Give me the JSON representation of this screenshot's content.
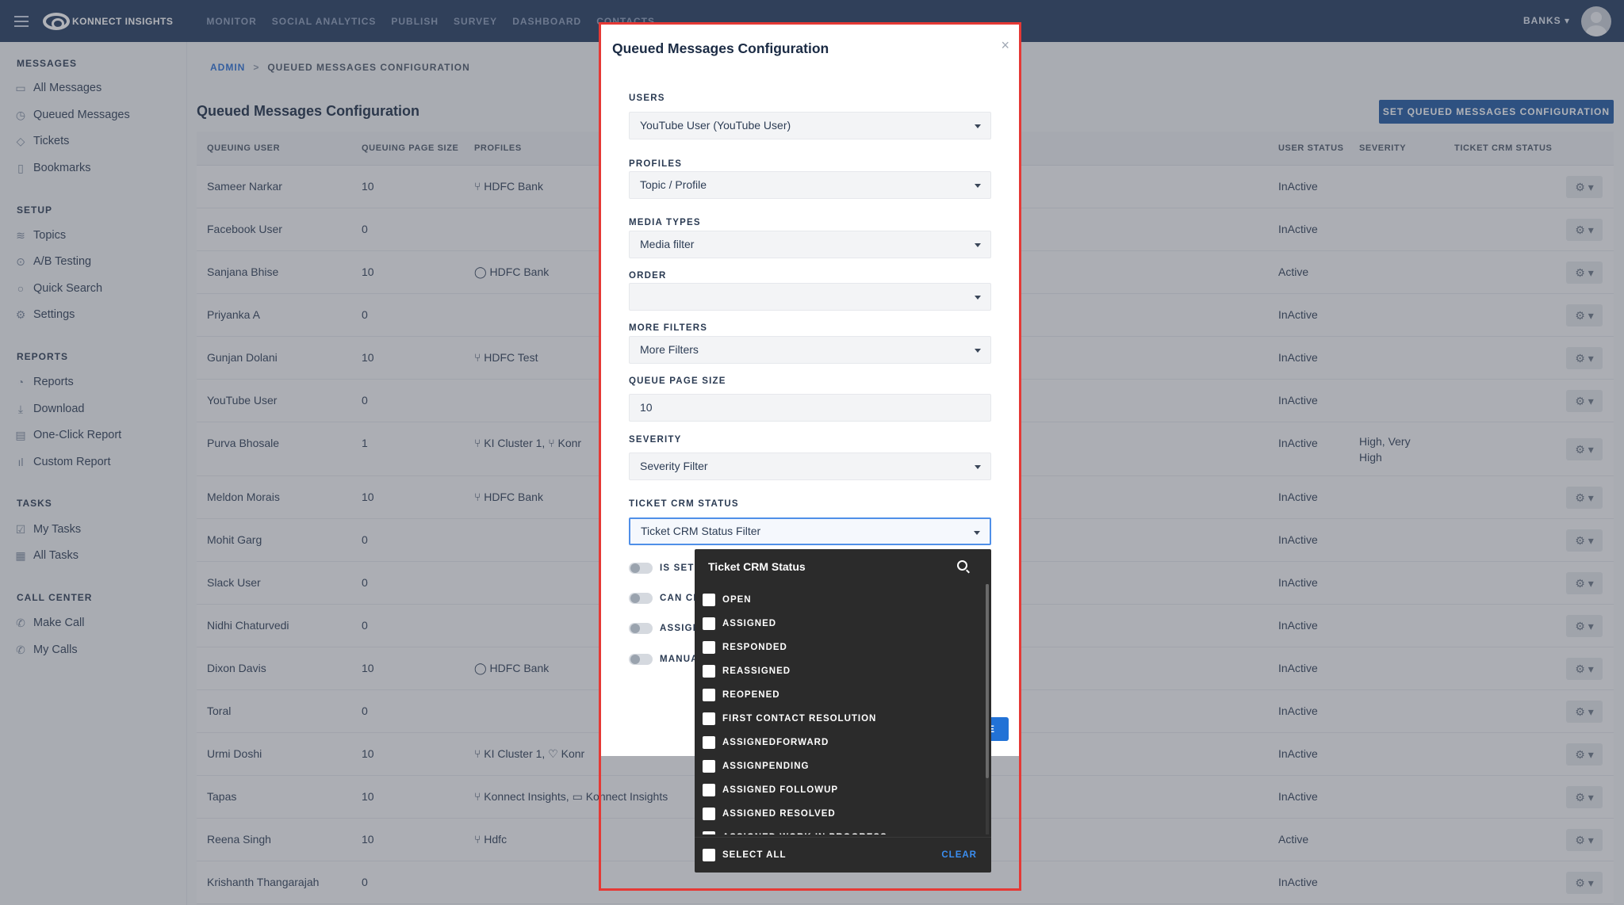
{
  "header": {
    "brand": "KONNECT INSIGHTS",
    "nav": [
      "MONITOR",
      "SOCIAL ANALYTICS",
      "PUBLISH",
      "SURVEY",
      "DASHBOARD",
      "CONTACTS"
    ],
    "account": "BANKS ▾"
  },
  "sidebar": {
    "sections": [
      {
        "title": "MESSAGES",
        "items": [
          "All Messages",
          "Queued Messages",
          "Tickets",
          "Bookmarks"
        ]
      },
      {
        "title": "SETUP",
        "items": [
          "Topics",
          "A/B Testing",
          "Quick Search",
          "Settings"
        ]
      },
      {
        "title": "REPORTS",
        "items": [
          "Reports",
          "Download",
          "One-Click Report",
          "Custom Report"
        ]
      },
      {
        "title": "TASKS",
        "items": [
          "My Tasks",
          "All Tasks"
        ]
      },
      {
        "title": "CALL CENTER",
        "items": [
          "Make Call",
          "My Calls"
        ]
      }
    ]
  },
  "breadcrumb": {
    "root": "ADMIN",
    "sep": ">",
    "current": "QUEUED MESSAGES CONFIGURATION"
  },
  "page": {
    "title": "Queued Messages Configuration",
    "action": "SET QUEUED MESSAGES CONFIGURATION"
  },
  "table": {
    "headers": {
      "queuing_user": "QUEUING USER",
      "page_size": "QUEUING PAGE SIZE",
      "profiles": "PROFILES",
      "user_status": "USER STATUS",
      "severity": "SEVERITY",
      "crm_status": "TICKET CRM STATUS"
    },
    "rows": [
      {
        "user": "Sameer Narkar",
        "size": "10",
        "profile": "⑂ HDFC Bank",
        "status": "InActive",
        "severity": ""
      },
      {
        "user": "Facebook User",
        "size": "0",
        "profile": "",
        "status": "InActive",
        "severity": ""
      },
      {
        "user": "Sanjana Bhise",
        "size": "10",
        "profile": "◯ HDFC Bank",
        "status": "Active",
        "severity": ""
      },
      {
        "user": "Priyanka A",
        "size": "0",
        "profile": "",
        "status": "InActive",
        "severity": ""
      },
      {
        "user": "Gunjan Dolani",
        "size": "10",
        "profile": "⑂ HDFC Test",
        "status": "InActive",
        "severity": ""
      },
      {
        "user": "YouTube User",
        "size": "0",
        "profile": "",
        "status": "InActive",
        "severity": ""
      },
      {
        "user": "Purva Bhosale",
        "size": "1",
        "profile": "⑂ KI Cluster 1, ⑂ Konr",
        "status": "InActive",
        "severity": "High, Very\nHigh"
      },
      {
        "user": "Meldon Morais",
        "size": "10",
        "profile": "⑂ HDFC Bank",
        "status": "InActive",
        "severity": ""
      },
      {
        "user": "Mohit Garg",
        "size": "0",
        "profile": "",
        "status": "InActive",
        "severity": ""
      },
      {
        "user": "Slack User",
        "size": "0",
        "profile": "",
        "status": "InActive",
        "severity": ""
      },
      {
        "user": "Nidhi Chaturvedi",
        "size": "0",
        "profile": "",
        "status": "InActive",
        "severity": ""
      },
      {
        "user": "Dixon Davis",
        "size": "10",
        "profile": "◯ HDFC Bank",
        "status": "InActive",
        "severity": ""
      },
      {
        "user": "Toral",
        "size": "0",
        "profile": "",
        "status": "InActive",
        "severity": ""
      },
      {
        "user": "Urmi Doshi",
        "size": "10",
        "profile": "⑂ KI Cluster 1, ♡ Konr",
        "status": "InActive",
        "severity": ""
      },
      {
        "user": "Tapas",
        "size": "10",
        "profile": "⑂ Konnect Insights, ▭ Konnect Insights",
        "status": "InActive",
        "severity": ""
      },
      {
        "user": "Reena Singh",
        "size": "10",
        "profile": "⑂ Hdfc",
        "status": "Active",
        "severity": ""
      },
      {
        "user": "Krishanth Thangarajah",
        "size": "0",
        "profile": "",
        "status": "InActive",
        "severity": ""
      }
    ]
  },
  "modal": {
    "title": "Queued Messages Configuration",
    "close": "×",
    "fields": {
      "users": {
        "label": "USERS",
        "value": "YouTube User (YouTube User)"
      },
      "profiles": {
        "label": "PROFILES",
        "value": "Topic / Profile"
      },
      "media": {
        "label": "MEDIA TYPES",
        "value": "Media filter"
      },
      "order": {
        "label": "ORDER",
        "value": ""
      },
      "more": {
        "label": "MORE FILTERS",
        "value": "More Filters"
      },
      "qsize": {
        "label": "QUEUE PAGE SIZE",
        "value": "10"
      },
      "severity": {
        "label": "SEVERITY",
        "value": "Severity Filter"
      },
      "crm": {
        "label": "TICKET CRM STATUS",
        "value": "Ticket CRM Status Filter"
      }
    },
    "toggles": [
      "IS SET",
      "CAN CH",
      "ASSIGN",
      "MANUA"
    ],
    "save_fragment": "E"
  },
  "dropdown": {
    "title": "Ticket CRM Status",
    "options": [
      "OPEN",
      "ASSIGNED",
      "RESPONDED",
      "REASSIGNED",
      "REOPENED",
      "FIRST CONTACT RESOLUTION",
      "ASSIGNEDFORWARD",
      "ASSIGNPENDING",
      "ASSIGNED FOLLOWUP",
      "ASSIGNED RESOLVED",
      "ASSIGNED WORK IN PROGRESS"
    ],
    "select_all": "SELECT ALL",
    "clear": "CLEAR"
  }
}
